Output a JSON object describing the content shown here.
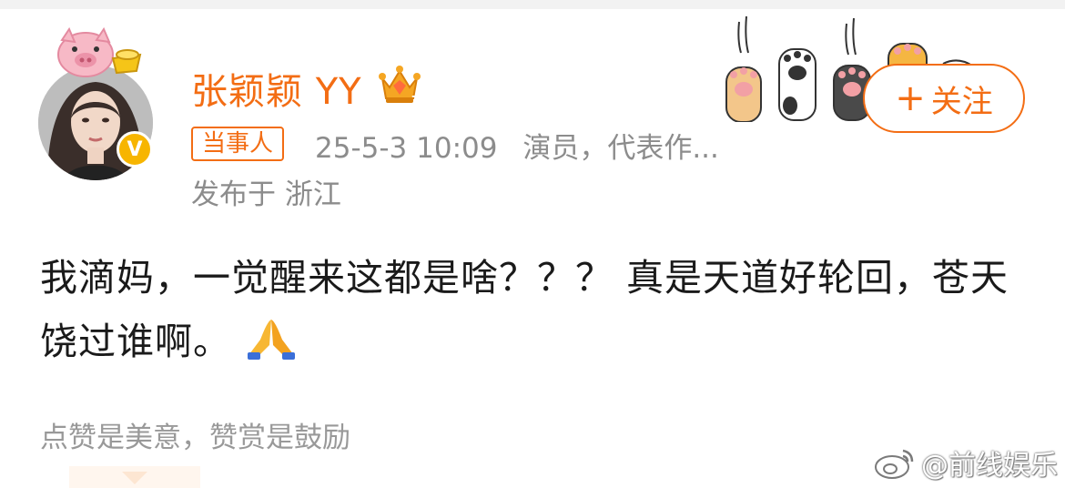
{
  "user": {
    "name": "张颖颖 YY",
    "verified_mark": "V",
    "party_badge": "当事人"
  },
  "meta": {
    "datetime": "25-5-3 10:09",
    "description": "演员，代表作...",
    "location": "发布于 浙江"
  },
  "follow": {
    "plus": "+",
    "label": "关注"
  },
  "post": {
    "text": "我滴妈，一觉醒来这都是啥？？？ 真是天道好轮回，苍天饶过谁啊。",
    "emoji": "folded-hands"
  },
  "reward": {
    "label": "点赞是美意，赞赏是鼓励"
  },
  "watermark": {
    "text": "@前线娱乐"
  },
  "colors": {
    "accent": "#f36d14",
    "meta_text": "#8c8c8c",
    "verified": "#f7b500"
  }
}
